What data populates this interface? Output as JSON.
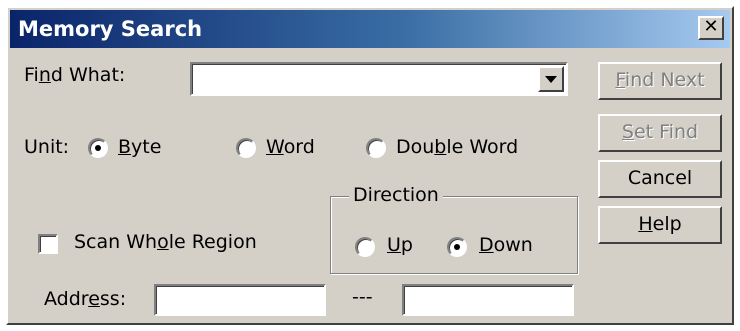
{
  "dialog": {
    "title": "Memory Search",
    "close_glyph": "✕"
  },
  "find_what": {
    "pre": "Fi",
    "accel": "n",
    "post": "d What:",
    "value": ""
  },
  "unit": {
    "label": "Unit:",
    "options": [
      {
        "pre": "",
        "accel": "B",
        "post": "yte",
        "selected": true
      },
      {
        "pre": "",
        "accel": "W",
        "post": "ord",
        "selected": false
      },
      {
        "pre": "Dou",
        "accel": "b",
        "post": "le Word",
        "selected": false
      }
    ]
  },
  "scan_whole_region": {
    "pre": "Scan Wh",
    "accel": "o",
    "post": "le Region",
    "checked": false
  },
  "direction": {
    "label": "Direction",
    "options": [
      {
        "pre": "",
        "accel": "U",
        "post": "p",
        "selected": false
      },
      {
        "pre": "",
        "accel": "D",
        "post": "own",
        "selected": true
      }
    ]
  },
  "address": {
    "pre": "Addr",
    "accel": "e",
    "post": "ss:",
    "separator": "---",
    "from_value": "",
    "to_value": ""
  },
  "buttons": {
    "find_next": {
      "pre": "",
      "accel": "F",
      "post": "ind Next",
      "enabled": false
    },
    "set_find": {
      "pre": "",
      "accel": "S",
      "post": "et Find",
      "enabled": false
    },
    "cancel": {
      "label": "Cancel",
      "enabled": true
    },
    "help": {
      "pre": "",
      "accel": "H",
      "post": "elp",
      "enabled": true
    }
  },
  "colors": {
    "title_start": "#0a246a",
    "title_end": "#a6caf0",
    "face": "#d4d0c8"
  }
}
